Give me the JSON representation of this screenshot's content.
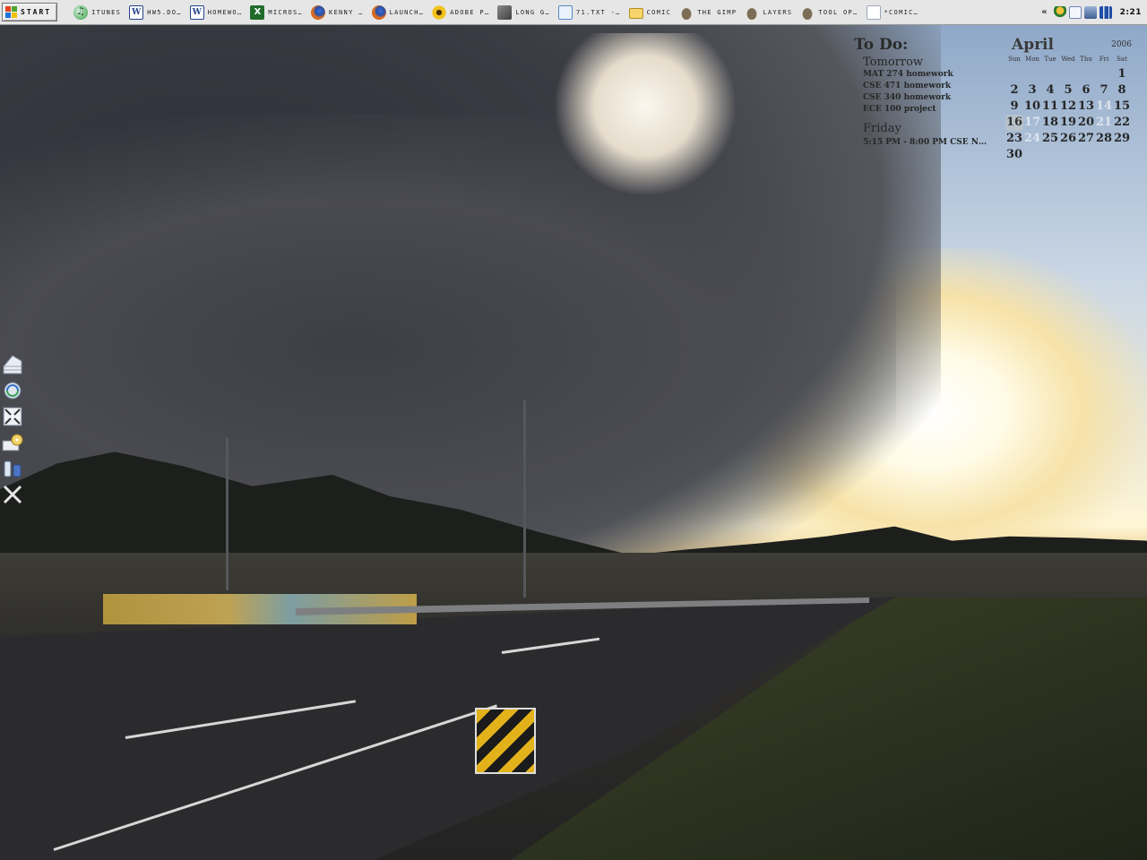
{
  "taskbar": {
    "start_label": "START",
    "tasks": [
      {
        "label": "ITUNES",
        "icon": "itunes-icon"
      },
      {
        "label": "HW5.DO…",
        "icon": "word-icon"
      },
      {
        "label": "HOMEWO…",
        "icon": "word-icon"
      },
      {
        "label": "MICROS…",
        "icon": "excel-icon"
      },
      {
        "label": "KENNY …",
        "icon": "firefox-icon"
      },
      {
        "label": "LAUNCH…",
        "icon": "firefox-icon"
      },
      {
        "label": "ADOBE P…",
        "icon": "sunflower-icon"
      },
      {
        "label": "LONG G…",
        "icon": "gimp-image-icon"
      },
      {
        "label": "71.TXT -…",
        "icon": "text-file-icon"
      },
      {
        "label": "COMIC",
        "icon": "folder-icon"
      },
      {
        "label": "THE GIMP",
        "icon": "gimp-icon"
      },
      {
        "label": "LAYERS",
        "icon": "gimp-icon"
      },
      {
        "label": "TOOL OP…",
        "icon": "gimp-icon"
      },
      {
        "label": "*COMIC…",
        "icon": "document-icon"
      }
    ],
    "tray": {
      "chevron": "«",
      "icons": [
        "messenger-icon",
        "mail-icon",
        "network-icon",
        "volume-icon"
      ],
      "clock": "2:21"
    }
  },
  "todo": {
    "title": "To Do:",
    "groups": [
      {
        "heading": "Tomorrow",
        "items": [
          "MAT 274 homework",
          "CSE 471 homework",
          "CSE 340 homework",
          "ECE 100 project"
        ]
      },
      {
        "heading": "Friday",
        "items": [
          "5:15 PM - 8:00 PM CSE N…"
        ]
      }
    ]
  },
  "calendar": {
    "month": "April",
    "year": "2006",
    "weekdays": [
      "Sun",
      "Mon",
      "Tue",
      "Wed",
      "Thu",
      "Fri",
      "Sat"
    ],
    "days": [
      "",
      "",
      "",
      "",
      "",
      "",
      "1",
      "2",
      "3",
      "4",
      "5",
      "6",
      "7",
      "8",
      "9",
      "10",
      "11",
      "12",
      "13",
      "14",
      "15",
      "16",
      "17",
      "18",
      "19",
      "20",
      "21",
      "22",
      "23",
      "24",
      "25",
      "26",
      "27",
      "28",
      "29",
      "30",
      "",
      "",
      "",
      "",
      "",
      ""
    ],
    "today": "16",
    "highlighted": [
      "14",
      "17",
      "21",
      "24"
    ]
  },
  "dock": {
    "icons": [
      "stack-icon",
      "sync-icon",
      "fullscreen-icon",
      "drive-icon",
      "battery-icon",
      "close-icon"
    ]
  },
  "colors": {
    "taskbar_bg": "#e6e6e6",
    "widget_text": "#262626",
    "calendar_today_bg": "#b8c2cc"
  }
}
